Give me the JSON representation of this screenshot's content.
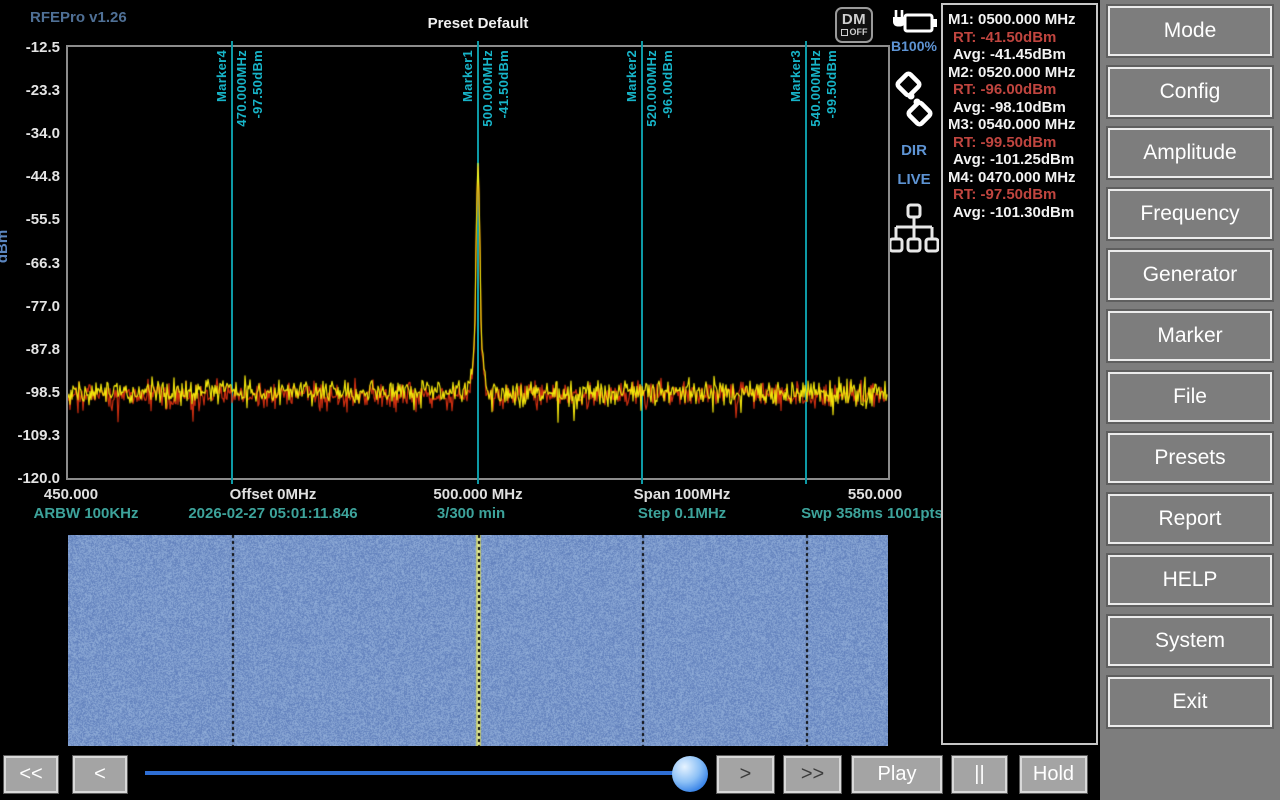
{
  "app": {
    "title": "RFEPro v1.26",
    "preset": "Preset Default"
  },
  "status": {
    "dm_label": "DM",
    "dm_state": "OFF",
    "battery_label": "B100%",
    "dir_label": "DIR",
    "live_label": "LIVE"
  },
  "spectrum": {
    "ylabel": "dBm",
    "y_ticks": [
      "-12.5",
      "-23.3",
      "-34.0",
      "-44.8",
      "-55.5",
      "-66.3",
      "-77.0",
      "-87.8",
      "-98.5",
      "-109.3",
      "-120.0"
    ],
    "top_dbm": -12.5,
    "bottom_dbm": -120.0,
    "freq_start_mhz": 450.0,
    "freq_end_mhz": 550.0,
    "noise_floor_dbm": -98.5,
    "peak": {
      "freq_mhz": 500.0,
      "dbm": -41.5
    },
    "x_row1": [
      "450.000",
      "Offset 0MHz",
      "500.000 MHz",
      "Span 100MHz",
      "550.000"
    ],
    "x_row2": [
      "ARBW 100KHz",
      "2026-02-27 05:01:11.846",
      "3/300 min",
      "Step 0.1MHz",
      "Swp 358ms  1001pts"
    ],
    "markers": [
      {
        "name": "Marker1",
        "freq_mhz": 500.0,
        "freq_label": "500.000MHz",
        "dbm_label": "-41.50dBm"
      },
      {
        "name": "Marker2",
        "freq_mhz": 520.0,
        "freq_label": "520.000MHz",
        "dbm_label": "-96.00dBm"
      },
      {
        "name": "Marker3",
        "freq_mhz": 540.0,
        "freq_label": "540.000MHz",
        "dbm_label": "-99.50dBm"
      },
      {
        "name": "Marker4",
        "freq_mhz": 470.0,
        "freq_label": "470.000MHz",
        "dbm_label": "-97.50dBm"
      }
    ]
  },
  "marker_panel": {
    "rows": [
      {
        "title": "M1: 0500.000 MHz",
        "rt": "RT: -41.50dBm",
        "avg": "Avg: -41.45dBm"
      },
      {
        "title": "M2: 0520.000 MHz",
        "rt": "RT: -96.00dBm",
        "avg": "Avg: -98.10dBm"
      },
      {
        "title": "M3: 0540.000 MHz",
        "rt": "RT: -99.50dBm",
        "avg": "Avg: -101.25dBm"
      },
      {
        "title": "M4: 0470.000 MHz",
        "rt": "RT: -97.50dBm",
        "avg": "Avg: -101.30dBm"
      }
    ]
  },
  "menu": {
    "buttons": [
      "Mode",
      "Config",
      "Amplitude",
      "Frequency",
      "Generator",
      "Marker",
      "File",
      "Presets",
      "Report",
      "HELP",
      "System",
      "Exit"
    ]
  },
  "transport": {
    "rewind": "<<",
    "back": "<",
    "forward": ">",
    "fast_forward": ">>",
    "play": "Play",
    "pause": "||",
    "hold": "Hold",
    "slider_position": 1.0
  },
  "colors": {
    "accent_teal": "#0d9aa6",
    "marker_text": "#17b4c8",
    "trace_yellow": "#f2e50c",
    "trace_red": "#cc2e10",
    "rt_red": "#c0453f",
    "slider_blue": "#2e6ed4",
    "waterfall_base": "#7a96ca",
    "waterfall_signal": "#e4ec9e"
  }
}
